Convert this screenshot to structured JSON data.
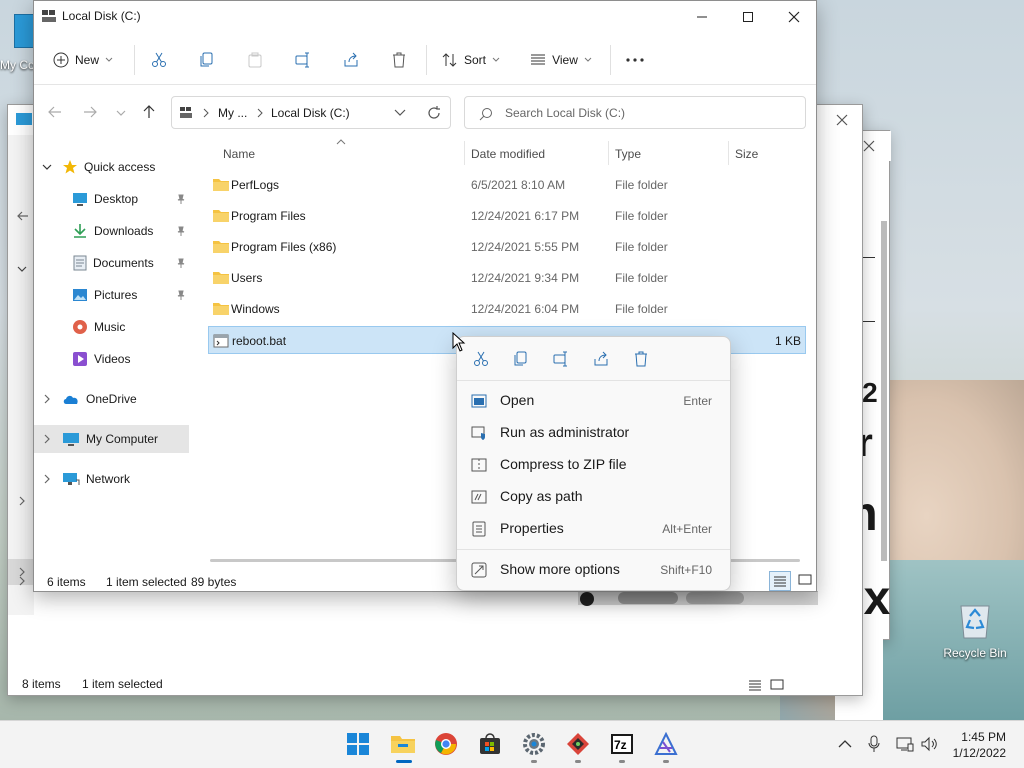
{
  "desktop": {
    "my_computer_label": "My Co",
    "recycle_bin_label": "Recycle Bin"
  },
  "back_window": {
    "status_items": "8 items",
    "status_selected": "1 item selected"
  },
  "back_right_window": {
    "snippets": [
      ". 12",
      "er",
      "m",
      "iox"
    ]
  },
  "explorer": {
    "title": "Local Disk (C:)",
    "toolbar": {
      "new_label": "New",
      "sort_label": "Sort",
      "view_label": "View"
    },
    "address": {
      "crumb_1": "My ...",
      "crumb_2": "Local Disk (C:)"
    },
    "search": {
      "placeholder": "Search Local Disk (C:)"
    },
    "nav": {
      "quick_access": "Quick access",
      "items": [
        {
          "label": "Desktop",
          "icon": "desktop-icon"
        },
        {
          "label": "Downloads",
          "icon": "downloads-icon"
        },
        {
          "label": "Documents",
          "icon": "documents-icon"
        },
        {
          "label": "Pictures",
          "icon": "pictures-icon"
        },
        {
          "label": "Music",
          "icon": "music-icon"
        },
        {
          "label": "Videos",
          "icon": "videos-icon"
        }
      ],
      "onedrive": "OneDrive",
      "my_computer": "My Computer",
      "network": "Network"
    },
    "columns": {
      "name": "Name",
      "date": "Date modified",
      "type": "Type",
      "size": "Size"
    },
    "rows": [
      {
        "name": "PerfLogs",
        "date": "6/5/2021 8:10 AM",
        "type": "File folder",
        "size": ""
      },
      {
        "name": "Program Files",
        "date": "12/24/2021 6:17 PM",
        "type": "File folder",
        "size": ""
      },
      {
        "name": "Program Files (x86)",
        "date": "12/24/2021 5:55 PM",
        "type": "File folder",
        "size": ""
      },
      {
        "name": "Users",
        "date": "12/24/2021 9:34 PM",
        "type": "File folder",
        "size": ""
      },
      {
        "name": "Windows",
        "date": "12/24/2021 6:04 PM",
        "type": "File folder",
        "size": ""
      },
      {
        "name": "reboot.bat",
        "date": "",
        "type": "",
        "size": "1 KB"
      }
    ],
    "status": {
      "items": "6 items",
      "selected": "1 item selected",
      "bytes": "89 bytes"
    }
  },
  "context_menu": {
    "items": [
      {
        "label": "Open",
        "shortcut": "Enter"
      },
      {
        "label": "Run as administrator",
        "shortcut": ""
      },
      {
        "label": "Compress to ZIP file",
        "shortcut": ""
      },
      {
        "label": "Copy as path",
        "shortcut": ""
      },
      {
        "label": "Properties",
        "shortcut": "Alt+Enter"
      }
    ],
    "more": {
      "label": "Show more options",
      "shortcut": "Shift+F10"
    }
  },
  "taskbar": {
    "time": "1:45 PM",
    "date": "1/12/2022",
    "apps": [
      "start-icon",
      "file-explorer-icon",
      "chrome-icon",
      "store-icon",
      "settings-icon",
      "app-red-icon",
      "7zip-icon",
      "app-blue-icon"
    ]
  },
  "colors": {
    "accent": "#0067c0",
    "folder": "#f5c342",
    "selection": "#cce4f7"
  }
}
